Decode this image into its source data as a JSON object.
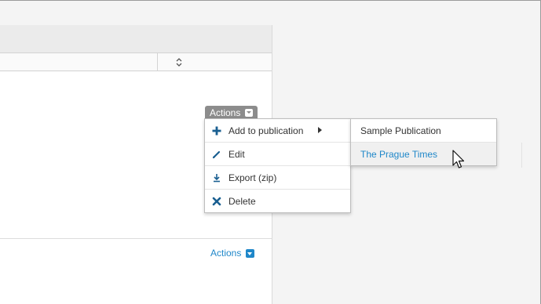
{
  "table": {
    "sort_icon": "sort-updown-icon"
  },
  "actions_button": {
    "label": "Actions",
    "icon": "caret-down-box-icon"
  },
  "actions_menu": {
    "items": [
      {
        "label": "Add to publication",
        "icon": "plus-icon",
        "has_submenu": true
      },
      {
        "label": "Edit",
        "icon": "pencil-icon"
      },
      {
        "label": "Export (zip)",
        "icon": "download-icon"
      },
      {
        "label": "Delete",
        "icon": "close-icon"
      }
    ]
  },
  "publication_submenu": {
    "items": [
      {
        "label": "Sample Publication",
        "hover": false
      },
      {
        "label": "The Prague Times",
        "hover": true
      }
    ]
  },
  "bottom_actions": {
    "label": "Actions",
    "icon": "caret-down-box-icon"
  },
  "colors": {
    "link": "#1f87c9",
    "icon_blue": "#1a5f91",
    "button_gray": "#8c8c8c"
  }
}
